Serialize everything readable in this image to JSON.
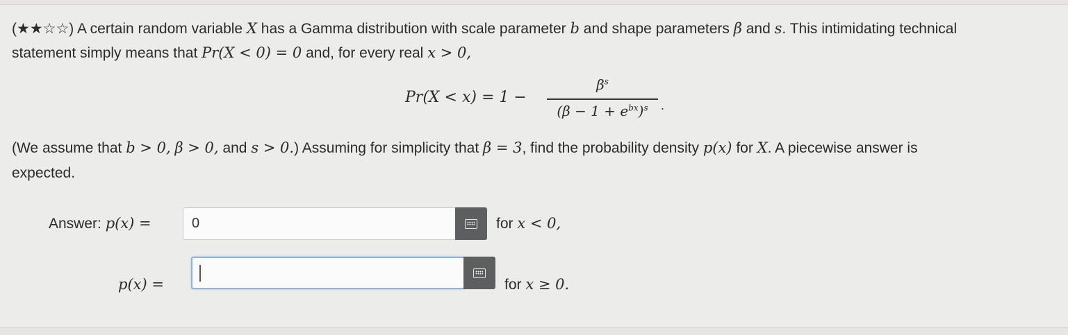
{
  "problem": {
    "stars": "(★★☆☆)",
    "line1_a": "A certain random variable",
    "var_X": "X",
    "line1_b": "has a Gamma distribution with scale parameter",
    "var_b": "b",
    "line1_c": "and shape parameters",
    "var_beta": "β",
    "line1_d": "and",
    "var_s": "s",
    "line1_e": ". This intimidating technical",
    "line2_a": "statement simply means that",
    "line2_math": "Pr(X < 0) = 0",
    "line2_b": "and, for every real",
    "line2_math2": "x > 0,",
    "display_lhs": "Pr(X < x) = 1 −",
    "frac_num": "β",
    "frac_num_sup": "s",
    "frac_den": "(β − 1 + e",
    "frac_den_sup1": "bx",
    "frac_den_close": ")",
    "frac_den_sup2": "s",
    "display_period": ".",
    "line3_a": "(We assume that",
    "line3_m1": "b > 0,",
    "line3_m2": "β > 0,",
    "line3_b": "and",
    "line3_m3": "s > 0.",
    "line3_c": ") Assuming for simplicity that",
    "line3_m4": "β = 3",
    "line3_d": ", find the probability density",
    "line3_m5": "p(x)",
    "line3_e": "for",
    "line3_m6": "X",
    "line3_f": ". A piecewise answer is",
    "line4": "expected."
  },
  "answer": {
    "label1": "Answer:",
    "label1_math": "p(x) =",
    "input1_value": "0",
    "cond1_text": "for",
    "cond1_math": "x < 0,",
    "label2_math": "p(x) =",
    "input2_value": "",
    "cond2_text": "for",
    "cond2_math": "x ≥ 0."
  },
  "icons": {
    "keyboard": "keyboard-icon"
  }
}
